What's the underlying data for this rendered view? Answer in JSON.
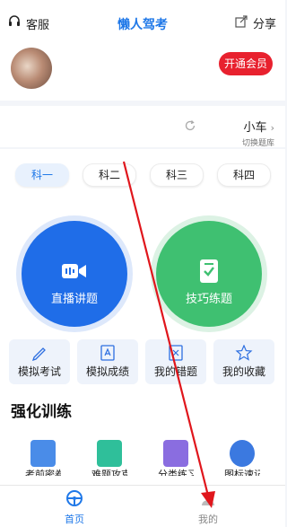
{
  "header": {
    "service_label": "客服",
    "title": "懒人驾考",
    "share_label": "分享"
  },
  "profile": {
    "vip_button": "开通会员"
  },
  "car_type": {
    "label": "小车",
    "sub_label": "切换题库"
  },
  "subject_tabs": [
    {
      "label": "科一",
      "active": true
    },
    {
      "label": "科二",
      "active": false
    },
    {
      "label": "科三",
      "active": false
    },
    {
      "label": "科四",
      "active": false
    }
  ],
  "main_actions": [
    {
      "label": "直播讲题",
      "color": "#1f6de8"
    },
    {
      "label": "技巧练题",
      "color": "#3fc071"
    }
  ],
  "quick_actions": [
    {
      "label": "模拟考试",
      "icon": "pencil-icon"
    },
    {
      "label": "模拟成绩",
      "icon": "grade-icon"
    },
    {
      "label": "我的错题",
      "icon": "wrong-answers-icon"
    },
    {
      "label": "我的收藏",
      "icon": "star-icon"
    }
  ],
  "training": {
    "title": "强化训练",
    "items": [
      {
        "label": "考前密卷",
        "color": "#4a8ce8"
      },
      {
        "label": "难题攻克",
        "color": "#2fbf9a"
      },
      {
        "label": "分类练习",
        "color": "#8a6de0"
      },
      {
        "label": "图标速记",
        "color": "#3b79e0"
      }
    ]
  },
  "bottom_nav": [
    {
      "label": "首页",
      "active": true
    },
    {
      "label": "我的",
      "active": false
    }
  ],
  "colors": {
    "accent": "#1f78e8",
    "annotation_arrow": "#e0161c"
  }
}
